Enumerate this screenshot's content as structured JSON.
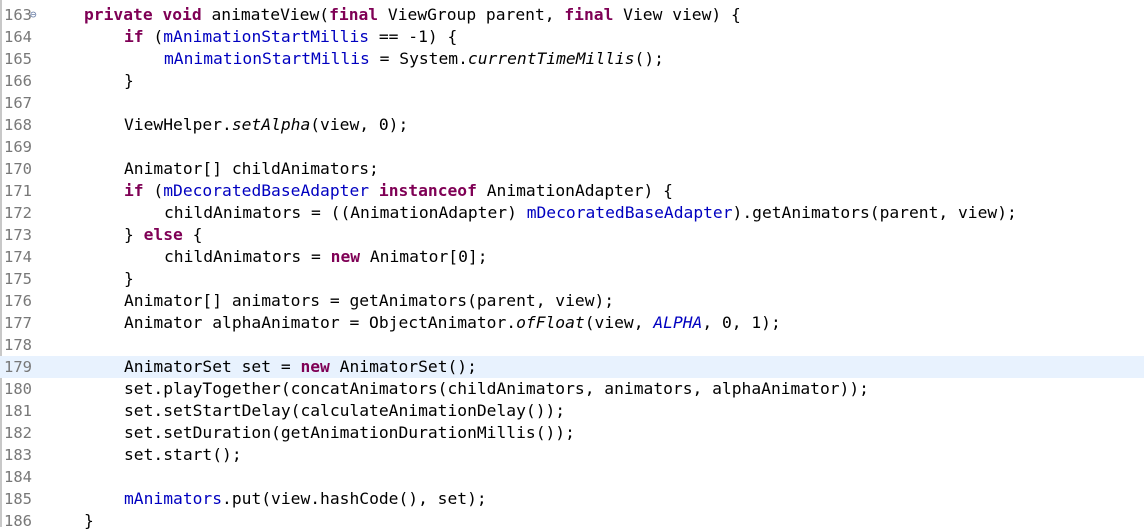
{
  "editor": {
    "current_line": "179",
    "fold_marker": "⊖",
    "lines": [
      {
        "n": "163",
        "segs": [
          [
            "kw",
            "private"
          ],
          [
            "p",
            " "
          ],
          [
            "kw",
            "void"
          ],
          [
            "p",
            " animateView("
          ],
          [
            "kw",
            "final"
          ],
          [
            "p",
            " ViewGroup parent, "
          ],
          [
            "kw",
            "final"
          ],
          [
            "p",
            " View view) {"
          ]
        ],
        "indent": 1
      },
      {
        "n": "164",
        "segs": [
          [
            "kw",
            "if"
          ],
          [
            "p",
            " ("
          ],
          [
            "fld",
            "mAnimationStartMillis"
          ],
          [
            "p",
            " == -1) {"
          ]
        ],
        "indent": 2
      },
      {
        "n": "165",
        "segs": [
          [
            "fld",
            "mAnimationStartMillis"
          ],
          [
            "p",
            " = System."
          ],
          [
            "sm",
            "currentTimeMillis"
          ],
          [
            "p",
            "();"
          ]
        ],
        "indent": 3
      },
      {
        "n": "166",
        "segs": [
          [
            "p",
            "}"
          ]
        ],
        "indent": 2
      },
      {
        "n": "167",
        "segs": [],
        "indent": 0
      },
      {
        "n": "168",
        "segs": [
          [
            "p",
            "ViewHelper."
          ],
          [
            "sm",
            "setAlpha"
          ],
          [
            "p",
            "(view, 0);"
          ]
        ],
        "indent": 2
      },
      {
        "n": "169",
        "segs": [],
        "indent": 0
      },
      {
        "n": "170",
        "segs": [
          [
            "p",
            "Animator[] childAnimators;"
          ]
        ],
        "indent": 2
      },
      {
        "n": "171",
        "segs": [
          [
            "kw",
            "if"
          ],
          [
            "p",
            " ("
          ],
          [
            "fld",
            "mDecoratedBaseAdapter"
          ],
          [
            "p",
            " "
          ],
          [
            "kw",
            "instanceof"
          ],
          [
            "p",
            " AnimationAdapter) {"
          ]
        ],
        "indent": 2
      },
      {
        "n": "172",
        "segs": [
          [
            "p",
            "childAnimators = ((AnimationAdapter) "
          ],
          [
            "fld",
            "mDecoratedBaseAdapter"
          ],
          [
            "p",
            ").getAnimators(parent, view);"
          ]
        ],
        "indent": 3
      },
      {
        "n": "173",
        "segs": [
          [
            "p",
            "} "
          ],
          [
            "kw",
            "else"
          ],
          [
            "p",
            " {"
          ]
        ],
        "indent": 2
      },
      {
        "n": "174",
        "segs": [
          [
            "p",
            "childAnimators = "
          ],
          [
            "kw",
            "new"
          ],
          [
            "p",
            " Animator[0];"
          ]
        ],
        "indent": 3
      },
      {
        "n": "175",
        "segs": [
          [
            "p",
            "}"
          ]
        ],
        "indent": 2
      },
      {
        "n": "176",
        "segs": [
          [
            "p",
            "Animator[] animators = getAnimators(parent, view);"
          ]
        ],
        "indent": 2
      },
      {
        "n": "177",
        "segs": [
          [
            "p",
            "Animator alphaAnimator = ObjectAnimator."
          ],
          [
            "sm",
            "ofFloat"
          ],
          [
            "p",
            "(view, "
          ],
          [
            "sfld",
            "ALPHA"
          ],
          [
            "p",
            ", 0, 1);"
          ]
        ],
        "indent": 2
      },
      {
        "n": "178",
        "segs": [],
        "indent": 0
      },
      {
        "n": "179",
        "segs": [
          [
            "p",
            "AnimatorSet set = "
          ],
          [
            "kw",
            "new"
          ],
          [
            "p",
            " AnimatorSet();"
          ]
        ],
        "indent": 2
      },
      {
        "n": "180",
        "segs": [
          [
            "p",
            "set.playTogether(concatAnimators(childAnimators, animators, alphaAnimator));"
          ]
        ],
        "indent": 2
      },
      {
        "n": "181",
        "segs": [
          [
            "p",
            "set.setStartDelay(calculateAnimationDelay());"
          ]
        ],
        "indent": 2
      },
      {
        "n": "182",
        "segs": [
          [
            "p",
            "set.setDuration(getAnimationDurationMillis());"
          ]
        ],
        "indent": 2
      },
      {
        "n": "183",
        "segs": [
          [
            "p",
            "set.start();"
          ]
        ],
        "indent": 2
      },
      {
        "n": "184",
        "segs": [],
        "indent": 0
      },
      {
        "n": "185",
        "segs": [
          [
            "fld",
            "mAnimators"
          ],
          [
            "p",
            ".put(view.hashCode(), set);"
          ]
        ],
        "indent": 2
      },
      {
        "n": "186",
        "segs": [
          [
            "p",
            "}"
          ]
        ],
        "indent": 1
      }
    ]
  }
}
